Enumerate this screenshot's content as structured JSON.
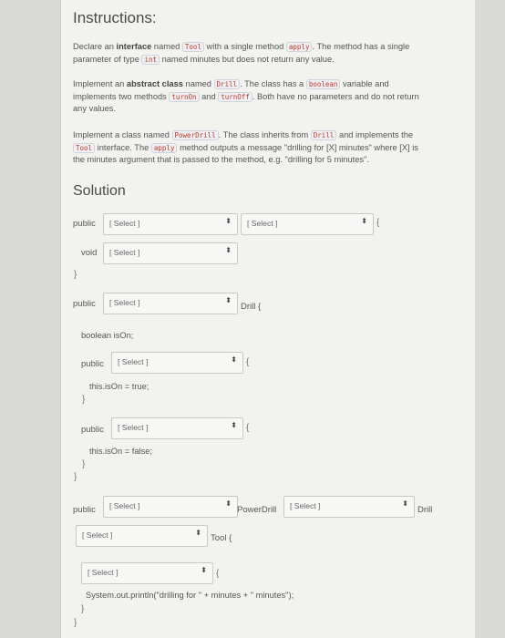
{
  "instructions": {
    "title": "Instructions:",
    "p1": {
      "a": "Declare an ",
      "b": "interface",
      "c": " named ",
      "tag1": "Tool",
      "d": " with a single method ",
      "tag2": "apply",
      "e": ". The method has a single",
      "line2a": "parameter of type ",
      "tag3": "int",
      "line2b": " named minutes but does not return any value."
    },
    "p2": {
      "a": "Implement an ",
      "b": "abstract class",
      "c": " named ",
      "tag1": "Drill",
      "d": ". The class has a ",
      "tag2": "boolean",
      "e": " variable and",
      "line2a": "implements two methods ",
      "tag3": "turnOn",
      "line2b": " and ",
      "tag4": "turnOff",
      "line2c": ". Both have no parameters and do not return",
      "line3": "any values."
    },
    "p3": {
      "a": "Implement a class named ",
      "tag1": "PowerDrill",
      "b": ". The class inherits from ",
      "tag2": "Drill",
      "c": " and implements the",
      "tag3": "Tool",
      "line2a": " interface. The ",
      "tag4": "apply",
      "line2b": " method outputs a message \"drilling for [X] minutes\" where [X] is",
      "line3": "the minutes argument that is passed to the method, e.g. \"drilling for 5 minutes\"."
    }
  },
  "solution": {
    "title": "Solution",
    "select_placeholder": "[ Select ]",
    "chevron": "⬍",
    "kw_public": "public",
    "kw_void": "void",
    "brace_open": "{",
    "brace_close": "}",
    "drill_brace": "Drill {",
    "boolean_line": "boolean isOn;",
    "turn_on_line": "this.isOn = true;",
    "turn_off_line": "this.isOn = false;",
    "powerdrill": "PowerDrill",
    "drill": "Drill",
    "tool_brace": "Tool {",
    "println_line": "System.out.println(\"drilling for \" + minutes + \" minutes\");"
  }
}
